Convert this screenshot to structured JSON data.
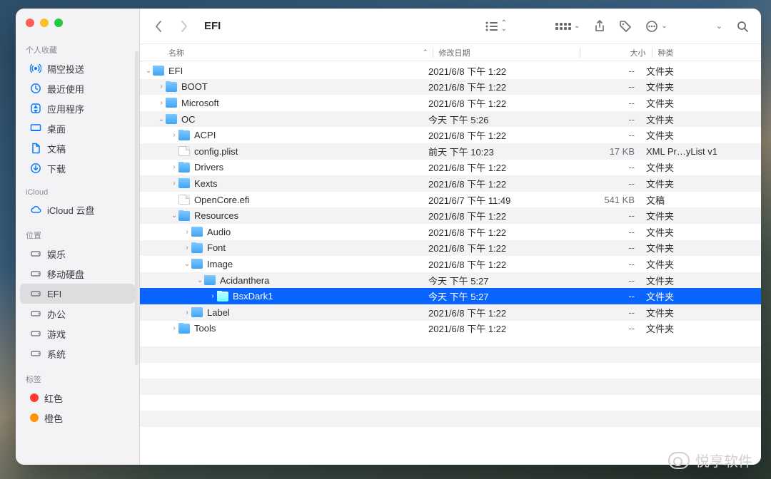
{
  "window": {
    "title": "EFI"
  },
  "sidebar": {
    "favorites_header": "个人收藏",
    "icloud_header": "iCloud",
    "locations_header": "位置",
    "tags_header": "标签",
    "favorites": [
      {
        "label": "隔空投送",
        "icon": "airdrop"
      },
      {
        "label": "最近使用",
        "icon": "clock"
      },
      {
        "label": "应用程序",
        "icon": "app"
      },
      {
        "label": "桌面",
        "icon": "desktop"
      },
      {
        "label": "文稿",
        "icon": "doc"
      },
      {
        "label": "下载",
        "icon": "download"
      }
    ],
    "icloud": [
      {
        "label": "iCloud 云盘",
        "icon": "cloud"
      }
    ],
    "locations": [
      {
        "label": "娱乐",
        "icon": "disk"
      },
      {
        "label": "移动硬盘",
        "icon": "disk"
      },
      {
        "label": "EFI",
        "icon": "disk",
        "selected": true
      },
      {
        "label": "办公",
        "icon": "disk"
      },
      {
        "label": "游戏",
        "icon": "disk"
      },
      {
        "label": "系统",
        "icon": "disk"
      }
    ],
    "tags": [
      {
        "label": "红色",
        "color": "red"
      },
      {
        "label": "橙色",
        "color": "orange"
      }
    ]
  },
  "columns": {
    "name": "名称",
    "date": "修改日期",
    "size": "大小",
    "kind": "种类"
  },
  "rows": [
    {
      "depth": 0,
      "expand": "open",
      "type": "folder",
      "name": "EFI",
      "date": "2021/6/8 下午 1:22",
      "size": "--",
      "kind": "文件夹"
    },
    {
      "depth": 1,
      "expand": "closed",
      "type": "folder",
      "name": "BOOT",
      "date": "2021/6/8 下午 1:22",
      "size": "--",
      "kind": "文件夹"
    },
    {
      "depth": 1,
      "expand": "closed",
      "type": "folder",
      "name": "Microsoft",
      "date": "2021/6/8 下午 1:22",
      "size": "--",
      "kind": "文件夹"
    },
    {
      "depth": 1,
      "expand": "open",
      "type": "folder",
      "name": "OC",
      "date": "今天 下午 5:26",
      "size": "--",
      "kind": "文件夹"
    },
    {
      "depth": 2,
      "expand": "closed",
      "type": "folder",
      "name": "ACPI",
      "date": "2021/6/8 下午 1:22",
      "size": "--",
      "kind": "文件夹"
    },
    {
      "depth": 2,
      "expand": "none",
      "type": "file",
      "name": "config.plist",
      "date": "前天 下午 10:23",
      "size": "17 KB",
      "kind": "XML Pr…yList v1"
    },
    {
      "depth": 2,
      "expand": "closed",
      "type": "folder",
      "name": "Drivers",
      "date": "2021/6/8 下午 1:22",
      "size": "--",
      "kind": "文件夹"
    },
    {
      "depth": 2,
      "expand": "closed",
      "type": "folder",
      "name": "Kexts",
      "date": "2021/6/8 下午 1:22",
      "size": "--",
      "kind": "文件夹"
    },
    {
      "depth": 2,
      "expand": "none",
      "type": "file",
      "name": "OpenCore.efi",
      "date": "2021/6/7 下午 11:49",
      "size": "541 KB",
      "kind": "文稿"
    },
    {
      "depth": 2,
      "expand": "open",
      "type": "folder",
      "name": "Resources",
      "date": "2021/6/8 下午 1:22",
      "size": "--",
      "kind": "文件夹"
    },
    {
      "depth": 3,
      "expand": "closed",
      "type": "folder",
      "name": "Audio",
      "date": "2021/6/8 下午 1:22",
      "size": "--",
      "kind": "文件夹"
    },
    {
      "depth": 3,
      "expand": "closed",
      "type": "folder",
      "name": "Font",
      "date": "2021/6/8 下午 1:22",
      "size": "--",
      "kind": "文件夹"
    },
    {
      "depth": 3,
      "expand": "open",
      "type": "folder",
      "name": "Image",
      "date": "2021/6/8 下午 1:22",
      "size": "--",
      "kind": "文件夹"
    },
    {
      "depth": 4,
      "expand": "open",
      "type": "folder",
      "name": "Acidanthera",
      "date": "今天 下午 5:27",
      "size": "--",
      "kind": "文件夹"
    },
    {
      "depth": 5,
      "expand": "closed",
      "type": "folder",
      "name": "BsxDark1",
      "date": "今天 下午 5:27",
      "size": "--",
      "kind": "文件夹",
      "selected": true
    },
    {
      "depth": 3,
      "expand": "closed",
      "type": "folder",
      "name": "Label",
      "date": "2021/6/8 下午 1:22",
      "size": "--",
      "kind": "文件夹"
    },
    {
      "depth": 2,
      "expand": "closed",
      "type": "folder",
      "name": "Tools",
      "date": "2021/6/8 下午 1:22",
      "size": "--",
      "kind": "文件夹"
    }
  ],
  "watermark": "悦享软件"
}
